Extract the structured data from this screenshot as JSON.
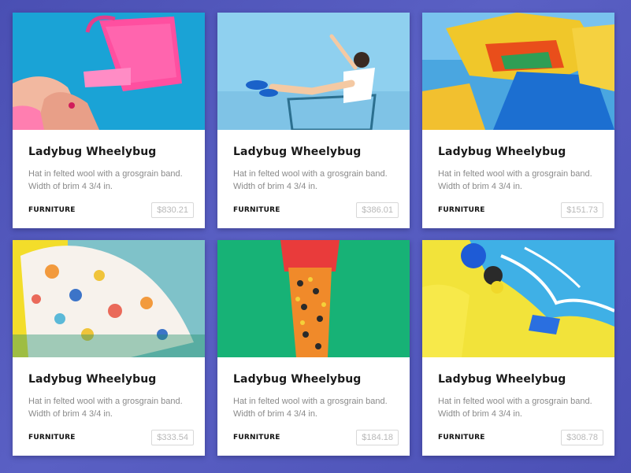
{
  "products": [
    {
      "title": "Ladybug Wheelybug",
      "description": "Hat in felted wool with a grosgrain band. Width of brim 4 3/4 in.",
      "category": "FURNITURE",
      "price": "$830.21"
    },
    {
      "title": "Ladybug Wheelybug",
      "description": "Hat in felted wool with a grosgrain band. Width of brim 4 3/4 in.",
      "category": "FURNITURE",
      "price": "$386.01"
    },
    {
      "title": "Ladybug Wheelybug",
      "description": "Hat in felted wool with a grosgrain band. Width of brim 4 3/4 in.",
      "category": "FURNITURE",
      "price": "$151.73"
    },
    {
      "title": "Ladybug Wheelybug",
      "description": "Hat in felted wool with a grosgrain band. Width of brim 4 3/4 in.",
      "category": "FURNITURE",
      "price": "$333.54"
    },
    {
      "title": "Ladybug Wheelybug",
      "description": "Hat in felted wool with a grosgrain band. Width of brim 4 3/4 in.",
      "category": "FURNITURE",
      "price": "$184.18"
    },
    {
      "title": "Ladybug Wheelybug",
      "description": "Hat in felted wool with a grosgrain band. Width of brim 4 3/4 in.",
      "category": "FURNITURE",
      "price": "$308.78"
    }
  ],
  "colors": {
    "background": "#5157bd",
    "card": "#ffffff",
    "title": "#1a1a1a",
    "description": "#8a8a8a",
    "price_border": "#d8d8d8"
  }
}
